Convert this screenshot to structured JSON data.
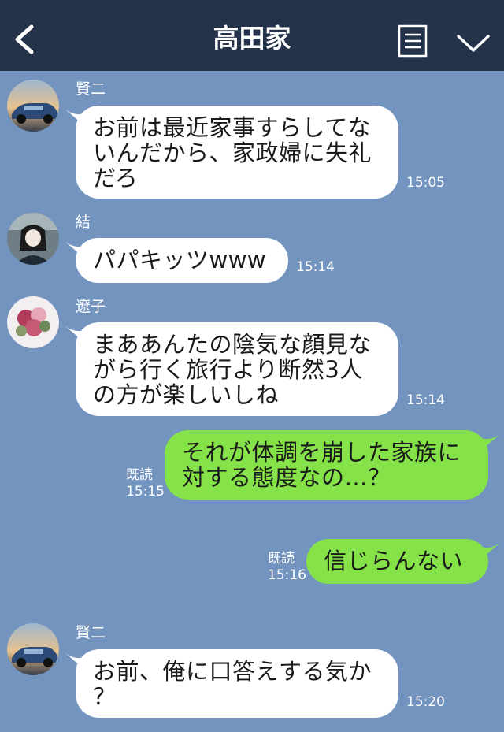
{
  "header": {
    "title": "高田家",
    "back_icon": "chevron-left-icon",
    "menu_icon": "menu-icon",
    "dropdown_icon": "chevron-down-icon"
  },
  "colors": {
    "header_bg": "#24324a",
    "chat_bg": "#7494c0",
    "bubble_in": "#ffffff",
    "bubble_out": "#85e249"
  },
  "messages": [
    {
      "direction": "in",
      "sender": "賢二",
      "lines": [
        "お前は最近家事すらしてな",
        "いんだから、家政婦に失礼",
        "だろ"
      ],
      "time": "15:05"
    },
    {
      "direction": "in",
      "sender": "結",
      "lines": [
        "パパキッツwww"
      ],
      "time": "15:14"
    },
    {
      "direction": "in",
      "sender": "遼子",
      "lines": [
        "まああんたの陰気な顔見な",
        "がら行く旅行より断然3人",
        "の方が楽しいしね"
      ],
      "time": "15:14"
    },
    {
      "direction": "out",
      "read": "既読",
      "lines": [
        "それが体調を崩した家族に",
        "対する態度なの…？"
      ],
      "time": "15:15"
    },
    {
      "direction": "out",
      "read": "既読",
      "lines": [
        "信じらんない"
      ],
      "time": "15:16"
    },
    {
      "direction": "in",
      "sender": "賢二",
      "lines": [
        "お前、俺に口答えする気か",
        "？"
      ],
      "time": "15:20"
    }
  ]
}
